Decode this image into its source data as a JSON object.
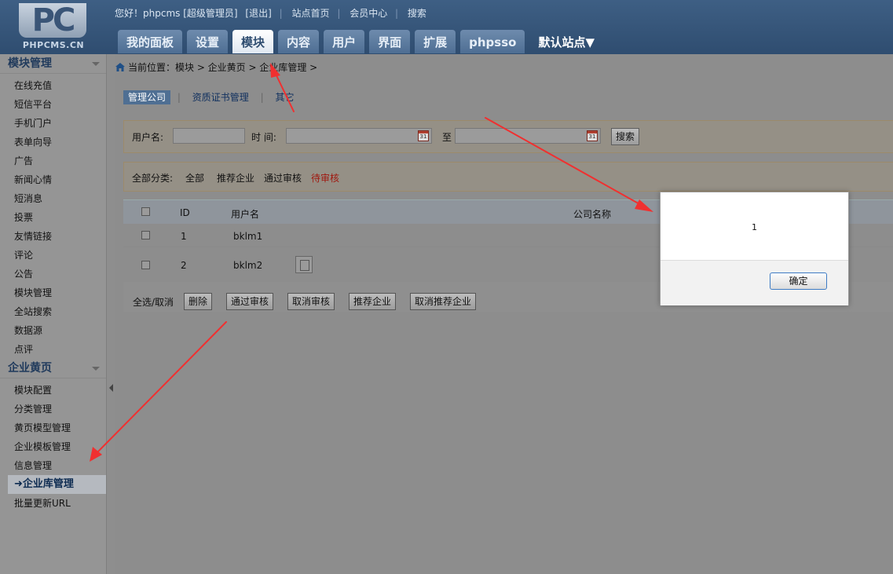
{
  "header": {
    "logo_mark": "PC",
    "logo_text": "PHPCMS.CN",
    "greeting": "您好！phpcms [超级管理员]",
    "logout": "[退出]",
    "site_home": "站点首页",
    "member_center": "会员中心",
    "search": "搜索",
    "tabs": [
      "我的面板",
      "设置",
      "模块",
      "内容",
      "用户",
      "界面",
      "扩展",
      "phpsso"
    ],
    "active_tab": "模块",
    "site_select": "默认站点▼"
  },
  "sidebar": {
    "group1_title": "模块管理",
    "group1_items": [
      "在线充值",
      "短信平台",
      "手机门户",
      "表单向导",
      "广告",
      "新闻心情",
      "短消息",
      "投票",
      "友情链接",
      "评论",
      "公告",
      "模块管理",
      "全站搜索",
      "数据源",
      "点评"
    ],
    "group2_title": "企业黄页",
    "group2_items": [
      "模块配置",
      "分类管理",
      "黄页模型管理",
      "企业模板管理",
      "信息管理"
    ],
    "active_item": "企业库管理",
    "last_item": "批量更新URL"
  },
  "breadcrumb": "当前位置：模块 > 企业黄页 > 企业库管理 >",
  "subtabs": {
    "manage_company": "管理公司",
    "certificate": "资质证书管理",
    "other": "其它"
  },
  "search_form": {
    "username_label": "用户名:",
    "time_label": "时 间:",
    "to_label": "至",
    "search_button": "搜索"
  },
  "filter": {
    "label": "全部分类:",
    "all": "全部",
    "recommended": "推荐企业",
    "approved": "通过审核",
    "pending": "待审核"
  },
  "table": {
    "headers": {
      "id": "ID",
      "username": "用户名",
      "company": "公司名称"
    },
    "rows": [
      {
        "id": "1",
        "username": "bklm1"
      },
      {
        "id": "2",
        "username": "bklm2"
      }
    ]
  },
  "actions": {
    "select_all": "全选/取消",
    "delete": "删除",
    "approve": "通过审核",
    "unapprove": "取消审核",
    "recommend": "推荐企业",
    "unrecommend": "取消推荐企业"
  },
  "dialog": {
    "message": "1",
    "ok": "确定"
  },
  "colors": {
    "header_blue": "#2f4d70",
    "pending_red": "#a0180f",
    "arrow_red": "#f03030"
  }
}
